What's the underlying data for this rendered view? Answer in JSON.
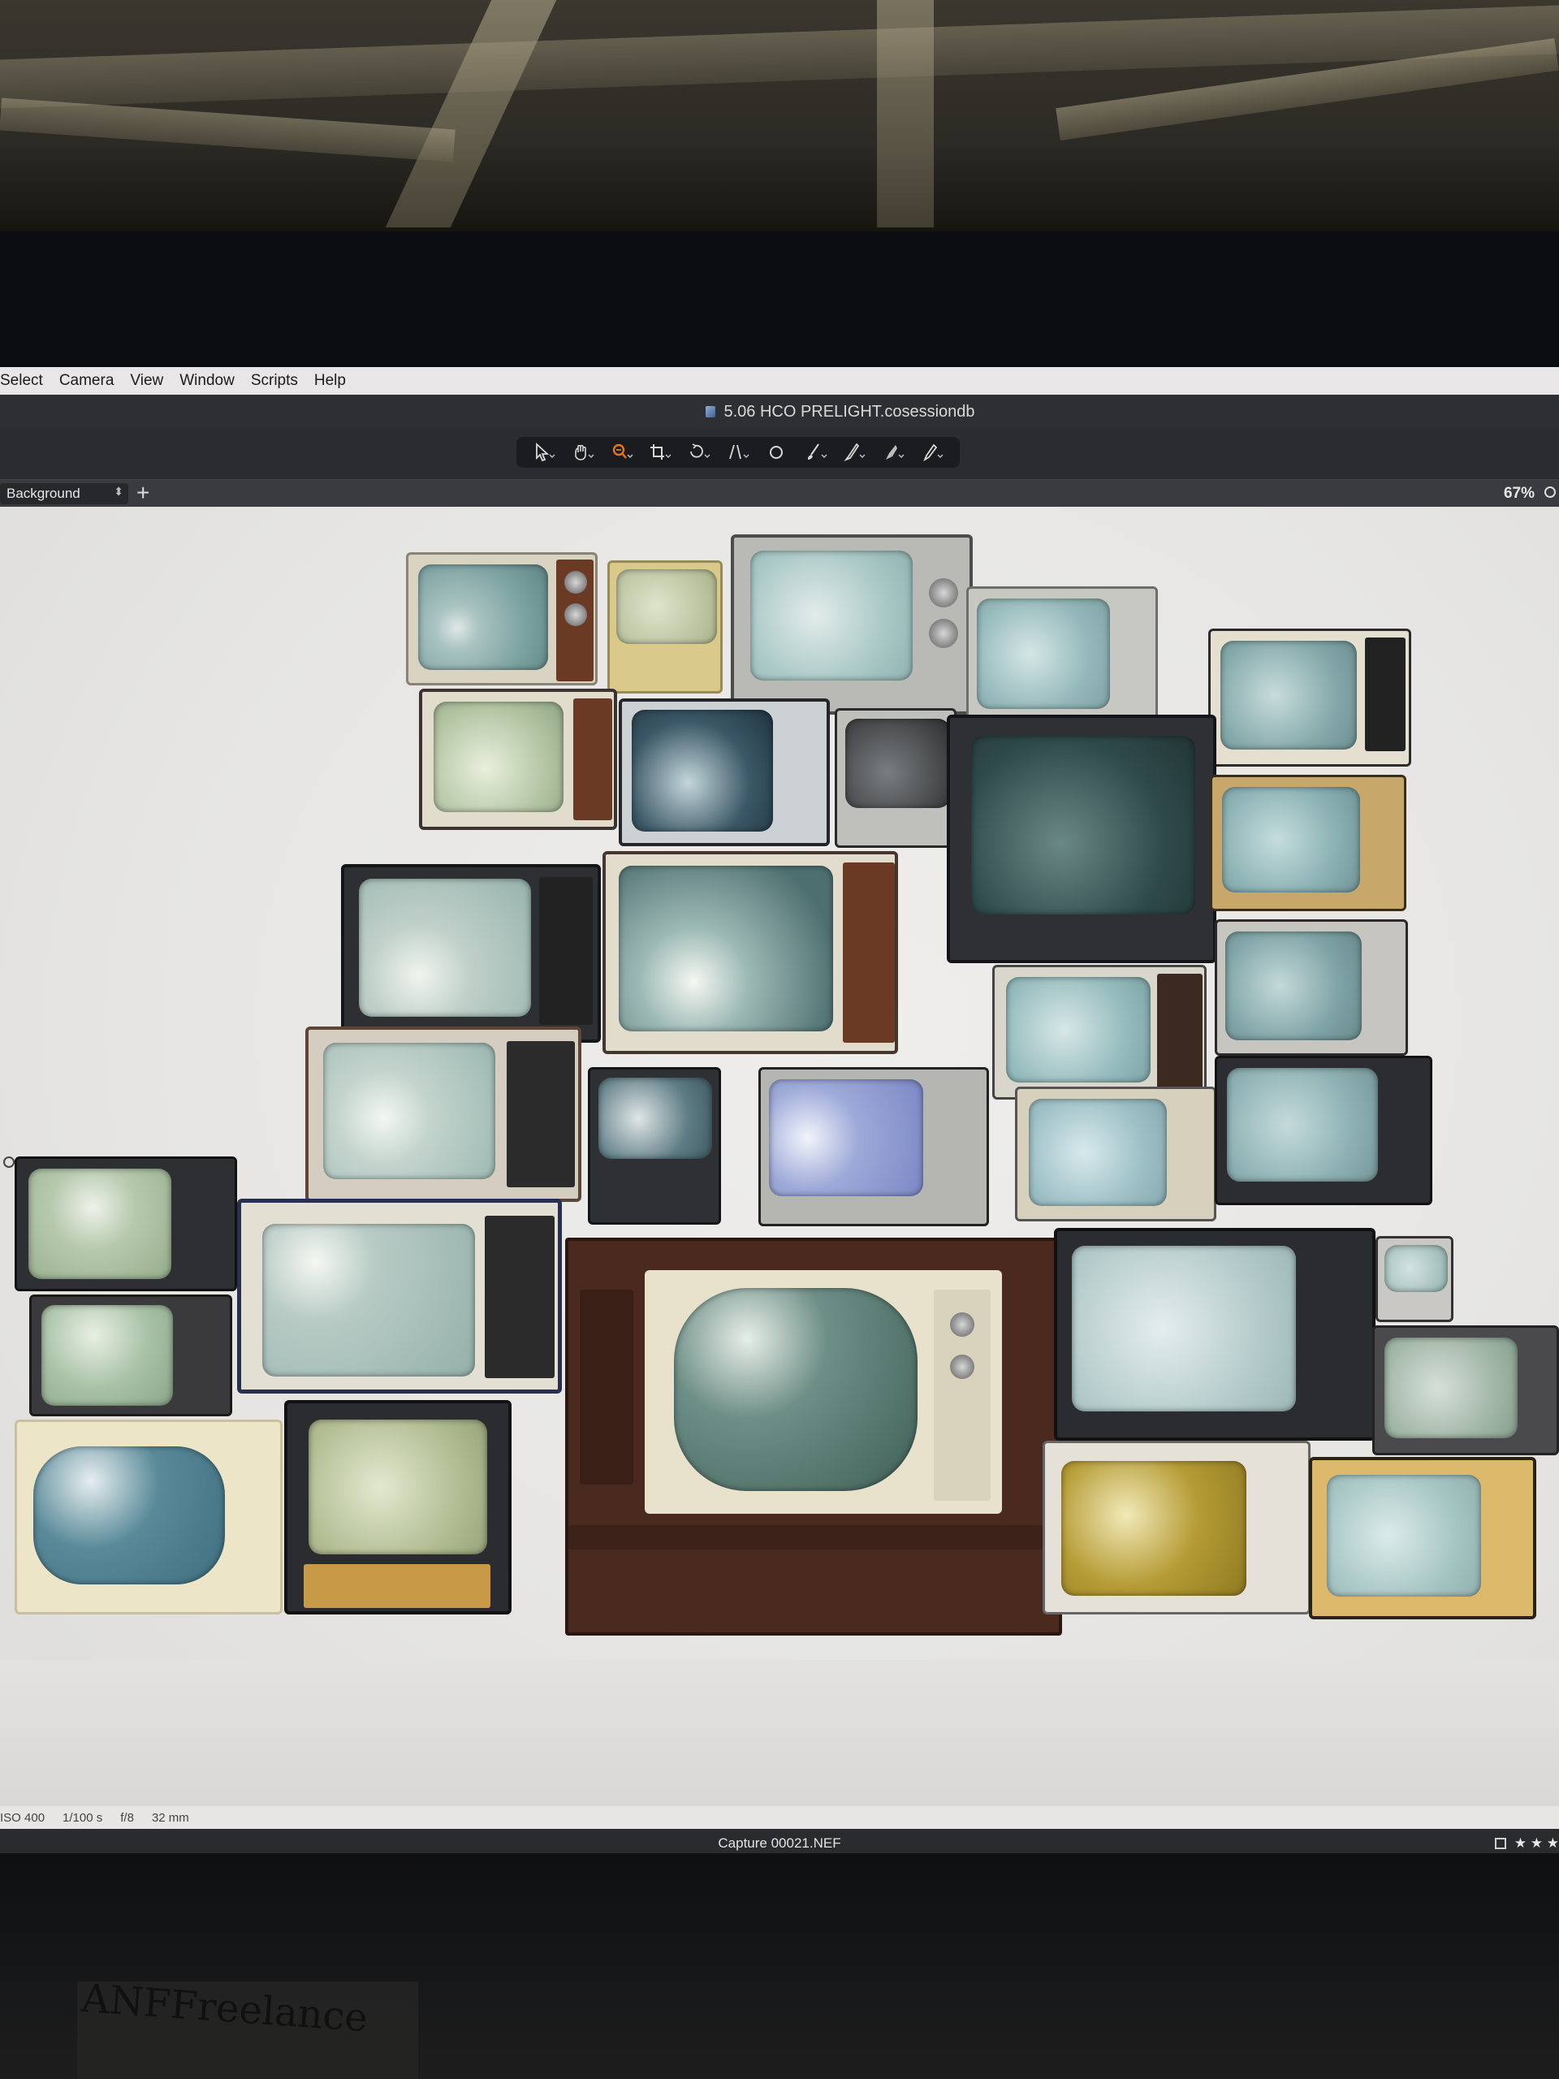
{
  "menu": {
    "items": [
      "Select",
      "Camera",
      "View",
      "Window",
      "Scripts",
      "Help"
    ]
  },
  "window": {
    "title": "5.06 HCO PRELIGHT.cosessiondb"
  },
  "toolbar": {
    "tools": [
      {
        "icon": "pointer-icon"
      },
      {
        "icon": "hand-icon"
      },
      {
        "icon": "zoom-icon"
      },
      {
        "icon": "crop-icon"
      },
      {
        "icon": "rotate-icon"
      },
      {
        "icon": "keystone-icon"
      },
      {
        "icon": "circle-icon"
      },
      {
        "icon": "brush-icon"
      },
      {
        "icon": "erase-brush-icon"
      },
      {
        "icon": "gradient-icon"
      },
      {
        "icon": "pen-icon"
      }
    ],
    "active_color": "#e0771f"
  },
  "layer_bar": {
    "layer_select": "Background",
    "zoom_level": "67%"
  },
  "capture_meta": {
    "iso": "ISO 400",
    "shutter": "1/100 s",
    "aperture": "f/8",
    "focal": "32 mm"
  },
  "filmstrip": {
    "filename": "Capture 00021.NEF",
    "rating": "★ ★ ★"
  },
  "note": {
    "text": "ANFFreelance"
  }
}
